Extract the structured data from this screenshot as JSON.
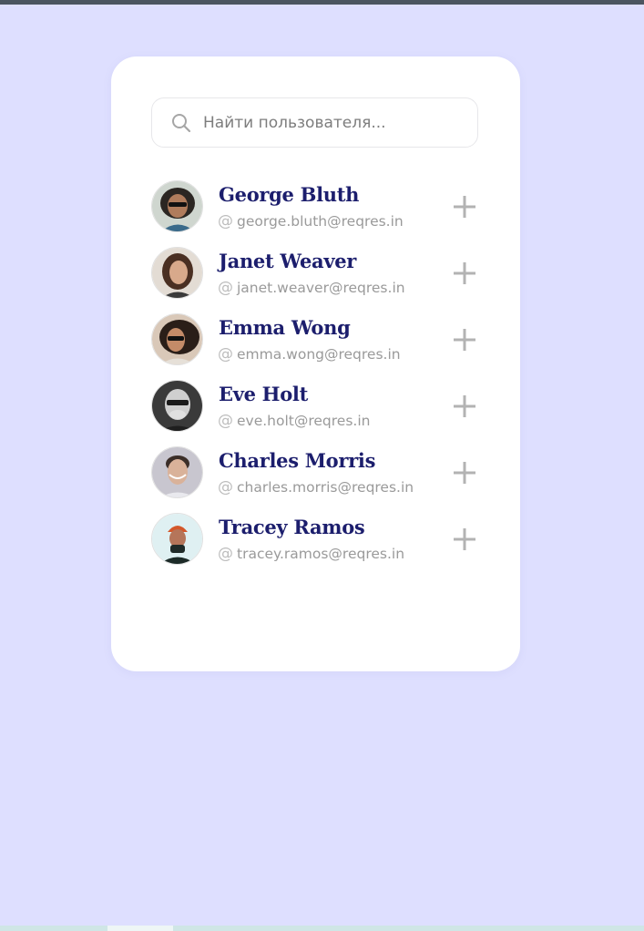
{
  "search": {
    "placeholder": "Найти пользователя...",
    "value": ""
  },
  "users": [
    {
      "name": "George Bluth",
      "email": "george.bluth@reqres.in"
    },
    {
      "name": "Janet Weaver",
      "email": "janet.weaver@reqres.in"
    },
    {
      "name": "Emma Wong",
      "email": "emma.wong@reqres.in"
    },
    {
      "name": "Eve Holt",
      "email": "eve.holt@reqres.in"
    },
    {
      "name": "Charles Morris",
      "email": "charles.morris@reqres.in"
    },
    {
      "name": "Tracey Ramos",
      "email": "tracey.ramos@reqres.in"
    }
  ],
  "icons": {
    "search": "search-icon",
    "email": "at-icon",
    "add": "plus-icon"
  },
  "colors": {
    "background": "#dedfff",
    "card": "#ffffff",
    "name": "#1c1e6d",
    "email": "#9a9a9a",
    "icon": "#bdbdbd"
  }
}
